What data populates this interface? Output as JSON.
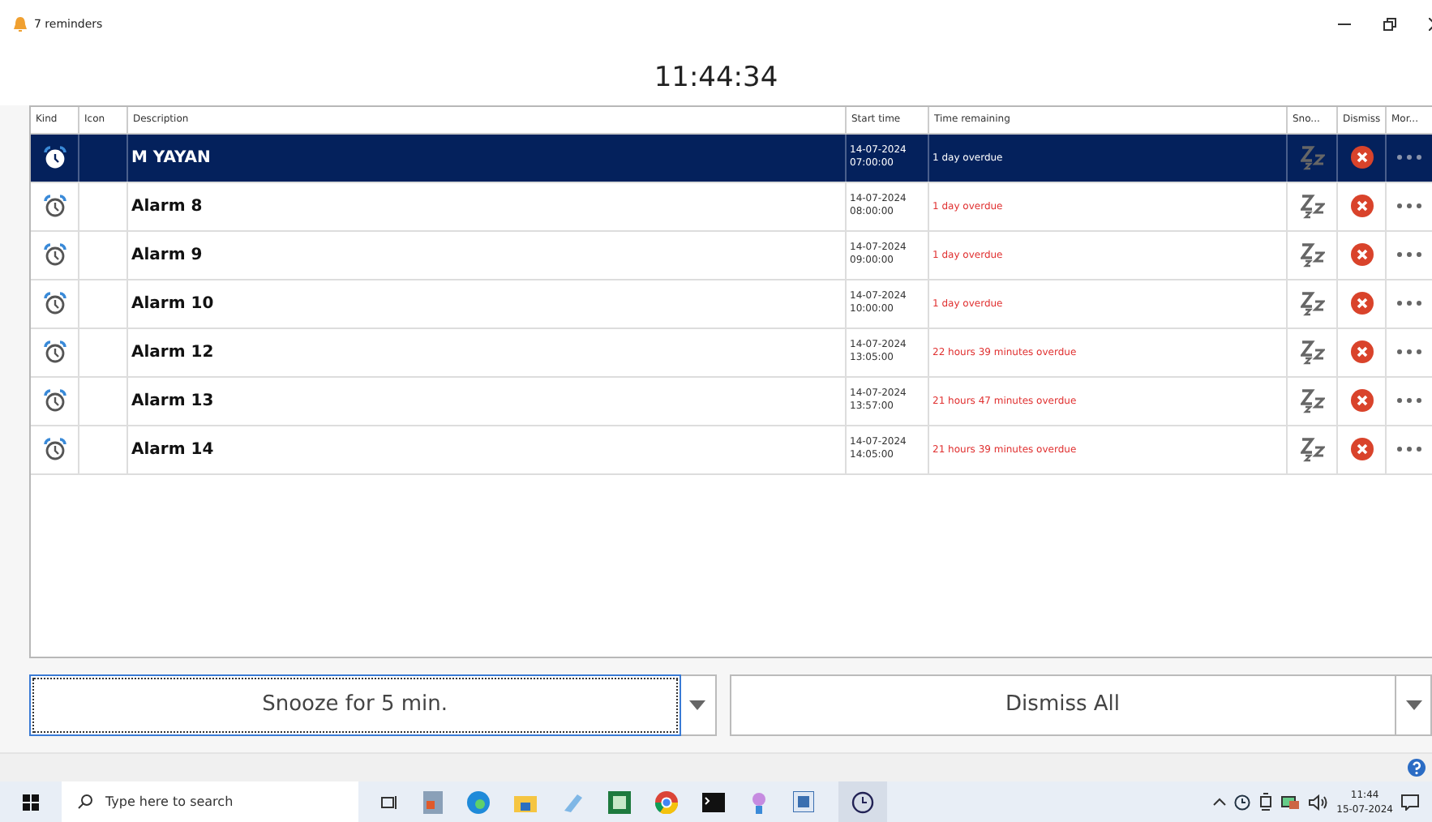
{
  "window": {
    "title": "7 reminders"
  },
  "clock": "11:44:34",
  "table": {
    "columns": [
      "Kind",
      "Icon",
      "Description",
      "Start time",
      "Time remaining",
      "Sno...",
      "Dismiss",
      "Mor..."
    ],
    "rows": [
      {
        "description": "M YAYAN",
        "start_date": "14-07-2024",
        "start_clock": "07:00:00",
        "remaining": "1 day overdue",
        "selected": true
      },
      {
        "description": "Alarm 8",
        "start_date": "14-07-2024",
        "start_clock": "08:00:00",
        "remaining": "1 day overdue",
        "selected": false
      },
      {
        "description": "Alarm 9",
        "start_date": "14-07-2024",
        "start_clock": "09:00:00",
        "remaining": "1 day overdue",
        "selected": false
      },
      {
        "description": "Alarm 10",
        "start_date": "14-07-2024",
        "start_clock": "10:00:00",
        "remaining": "1 day overdue",
        "selected": false
      },
      {
        "description": "Alarm 12",
        "start_date": "14-07-2024",
        "start_clock": "13:05:00",
        "remaining": "22 hours 39 minutes overdue",
        "selected": false
      },
      {
        "description": "Alarm 13",
        "start_date": "14-07-2024",
        "start_clock": "13:57:00",
        "remaining": "21 hours 47 minutes overdue",
        "selected": false
      },
      {
        "description": "Alarm 14",
        "start_date": "14-07-2024",
        "start_clock": "14:05:00",
        "remaining": "21 hours 39 minutes overdue",
        "selected": false
      }
    ]
  },
  "buttons": {
    "snooze": "Snooze for 5 min.",
    "dismiss_all": "Dismiss All"
  },
  "taskbar": {
    "search_placeholder": "Type here to search",
    "time": "11:44",
    "date": "15-07-2024"
  }
}
